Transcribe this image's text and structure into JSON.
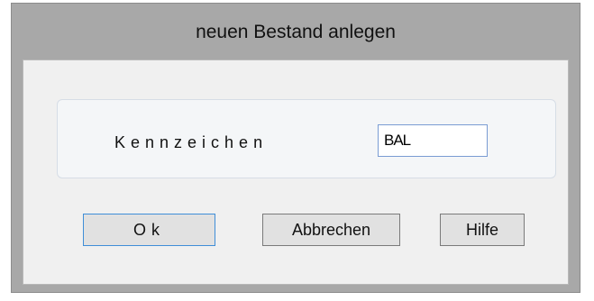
{
  "window": {
    "title": "neuen Bestand anlegen"
  },
  "form": {
    "field_label": "Kennzeichen",
    "field_value": "BAL"
  },
  "buttons": {
    "ok_label": "Ok",
    "cancel_label": "Abbrechen",
    "help_label": "Hilfe"
  },
  "colors": {
    "frame": "#a8a8a8",
    "client_background": "#f0f0f0",
    "focus_border": "#3f8ed8"
  }
}
